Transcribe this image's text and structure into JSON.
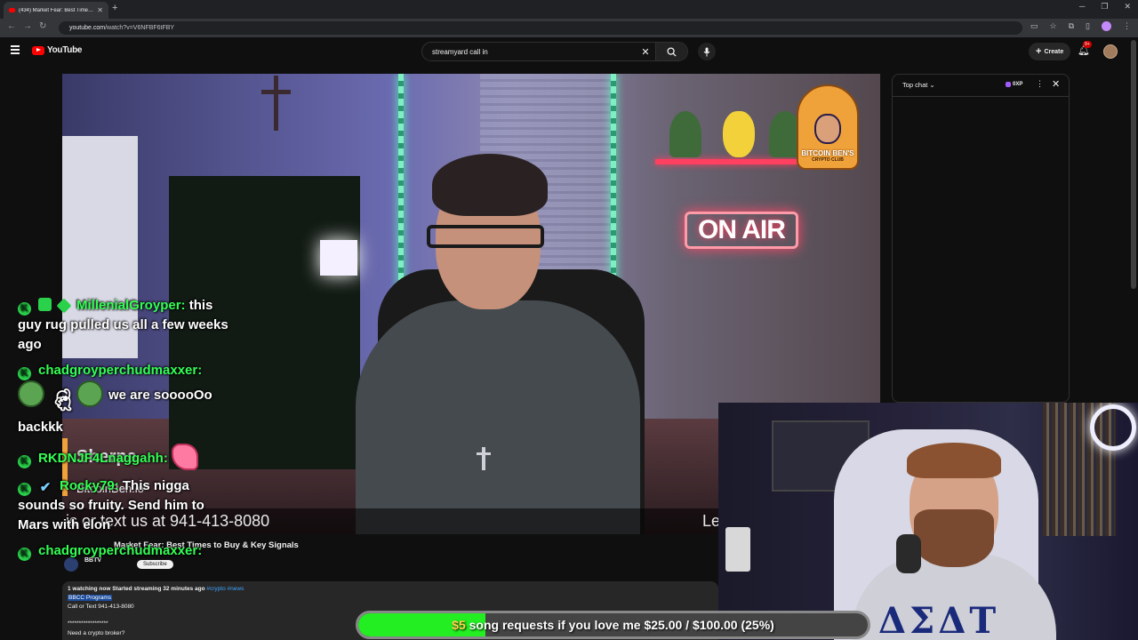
{
  "browser": {
    "tab_title": "(434) Market Fear: Best Times to Buy & Key Signals",
    "url_host": "youtube.com",
    "url_path": "/watch?v=V6NFBF6tFBY"
  },
  "masthead": {
    "logo_text": "YouTube",
    "search_value": "streamyard call in",
    "create_label": "Create",
    "notification_count": "9+"
  },
  "video": {
    "lower_third_name": "Sherpa",
    "lower_third_site": "BitcoinBen.io",
    "lower_third_call": "is or text us at 941-413-8080",
    "lower_third_right": "Le",
    "onair_sign": "ON AIR",
    "logo_line1": "BITCOIN BEN'S",
    "logo_line2": "CRYPTO CLUB"
  },
  "info": {
    "title": "Market Fear: Best Times to Buy & Key Signals",
    "channel_name": "BBTV",
    "subscribe_label": "Subscribe",
    "stats": "1 watching now  Started streaming 32 minutes ago ",
    "tags": "#crypto #news",
    "program_link": "BBCC Programs",
    "call_line": "Call or Text 941-413-8080",
    "stars_line": "******************",
    "need_line": "Need a crypto broker?"
  },
  "chat_panel": {
    "mode_label": "Top chat",
    "xp_label": "0XP"
  },
  "overlay_chat": [
    {
      "user": "MillenialGroyper:",
      "text": "this guy rug pulled us all a few weeks ago"
    },
    {
      "user": "chadgroyperchudmaxxer:",
      "text": "we are sooooOo backkk"
    },
    {
      "user": "RKDNJF4Lnaggahh:",
      "text": ""
    },
    {
      "user": "Rocky79:",
      "text": "This nigga sounds so fruity. Send him to Mars with elon"
    },
    {
      "user": "chadgroyperchudmaxxer:",
      "text": ""
    }
  ],
  "goal_bar": {
    "dollar_sign": "$5",
    "text": "song requests if you love me $25.00 / $100.00 (25%)",
    "progress": 0.25
  },
  "colors": {
    "youtube_red": "#ff0000",
    "chat_username": "#33ff55",
    "goal_fill": "#22ee22"
  }
}
